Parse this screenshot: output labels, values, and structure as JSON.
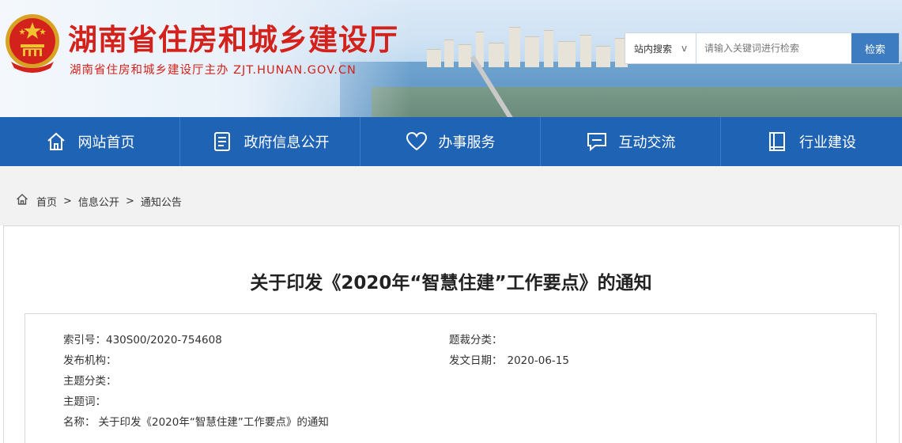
{
  "header": {
    "site_title": "湖南省住房和城乡建设厅",
    "site_subtitle": "湖南省住房和城乡建设厅主办 ZJT.HUNAN.GOV.CN",
    "search": {
      "scope_label": "站内搜索",
      "scope_caret": "v",
      "placeholder": "请输入关键词进行检索",
      "button_label": "检索"
    }
  },
  "nav": {
    "items": [
      {
        "label": "网站首页",
        "icon": "home-icon"
      },
      {
        "label": "政府信息公开",
        "icon": "document-list-icon"
      },
      {
        "label": "办事服务",
        "icon": "heart-icon"
      },
      {
        "label": "互动交流",
        "icon": "chat-icon"
      },
      {
        "label": "行业建设",
        "icon": "book-icon"
      }
    ]
  },
  "breadcrumb": {
    "items": [
      "首页",
      "信息公开",
      "通知公告"
    ],
    "separator": ">"
  },
  "article": {
    "title": "关于印发《2020年“智慧住建”工作要点》的通知",
    "meta": {
      "index_no_label": "索引号：",
      "index_no": "430S00/2020-754608",
      "topic_cat_label": "题裁分类：",
      "topic_cat": "",
      "publisher_label": "发布机构：",
      "publisher": "",
      "date_label": "发文日期：",
      "date": "2020-06-15",
      "subject_cat_label": "主题分类：",
      "subject_cat": "",
      "keywords_label": "主题词：",
      "keywords": "",
      "name_label": "名称：",
      "name": "关于印发《2020年“智慧住建”工作要点》的通知"
    }
  },
  "colors": {
    "brand_red": "#d3221c",
    "nav_blue": "#1f63b4",
    "search_button": "#3d7cc0"
  }
}
